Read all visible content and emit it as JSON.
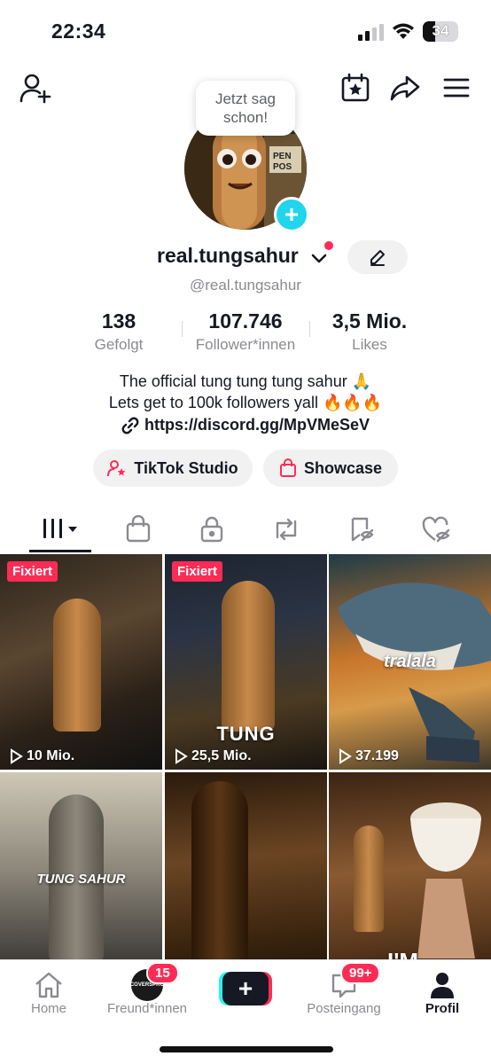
{
  "status_bar": {
    "time": "22:34",
    "battery": "34"
  },
  "tooltip": {
    "text": "Jetzt sag schon!"
  },
  "profile": {
    "username": "real.tungsahur",
    "handle": "@real.tungsahur",
    "stats": {
      "following": {
        "value": "138",
        "label": "Gefolgt"
      },
      "followers": {
        "value": "107.746",
        "label": "Follower*innen"
      },
      "likes": {
        "value": "3,5 Mio.",
        "label": "Likes"
      }
    },
    "bio_line1": "The official tung tung tung sahur 🙏",
    "bio_line2": "Lets get to 100k followers yall 🔥🔥🔥",
    "link": "https://discord.gg/MpVMeSeV"
  },
  "actions": {
    "studio": "TikTok Studio",
    "showcase": "Showcase"
  },
  "tabs": [
    {
      "name": "videos",
      "icon": "grid-icon",
      "active": true
    },
    {
      "name": "shop",
      "icon": "bag-icon"
    },
    {
      "name": "private",
      "icon": "lock-icon"
    },
    {
      "name": "reposts",
      "icon": "repost-icon"
    },
    {
      "name": "favorites",
      "icon": "bookmark-icon"
    },
    {
      "name": "liked",
      "icon": "heart-icon"
    }
  ],
  "videos": [
    {
      "pinned": "Fixiert",
      "views": "10 Mio.",
      "overlay": ""
    },
    {
      "pinned": "Fixiert",
      "views": "25,5 Mio.",
      "overlay": "TUNG"
    },
    {
      "pinned": "",
      "views": "37.199",
      "overlay": "tralala"
    },
    {
      "pinned": "",
      "views": "",
      "overlay": "TUNG SAHUR"
    },
    {
      "pinned": "",
      "views": "",
      "overlay": ""
    },
    {
      "pinned": "",
      "views": "",
      "overlay": "I'M"
    }
  ],
  "bottom_nav": {
    "home": "Home",
    "friends": "Freund*innen",
    "friends_badge": "15",
    "inbox": "Posteingang",
    "inbox_badge": "99+",
    "profile": "Profil",
    "friend_avatar_text": "COVERSPRO"
  },
  "colors": {
    "accent": "#fe2c55",
    "cyan": "#20d5ec",
    "text": "#161823",
    "muted": "#8a8b91"
  }
}
